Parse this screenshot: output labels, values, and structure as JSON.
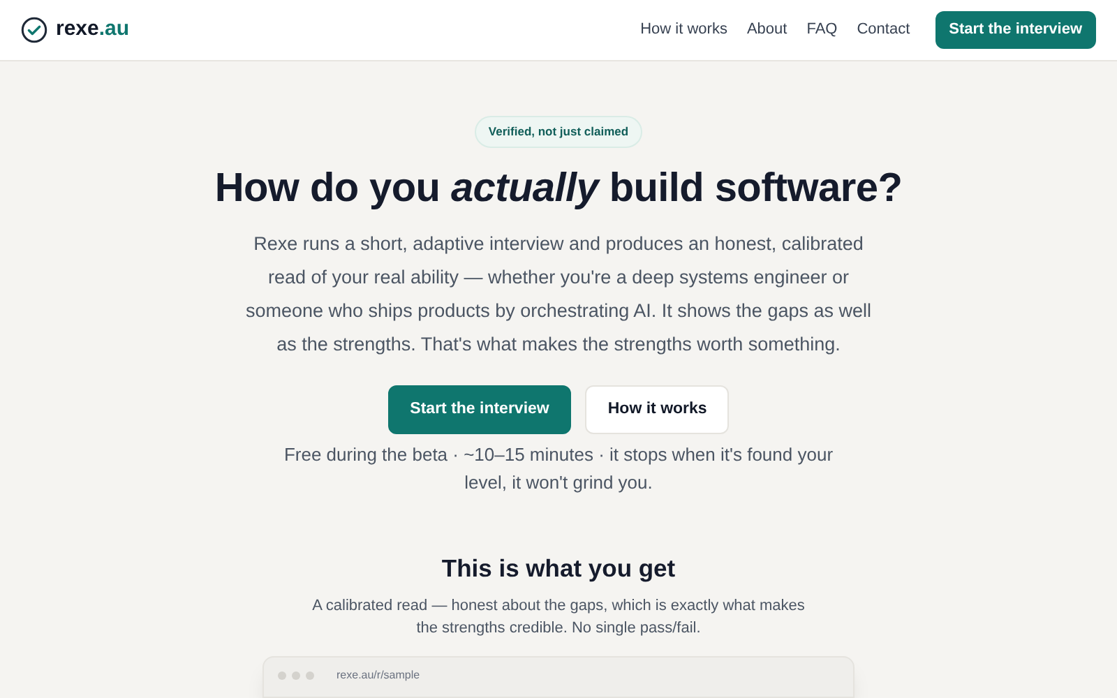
{
  "header": {
    "logo": {
      "name": "rexe",
      "tld": ".au"
    },
    "nav": [
      "How it works",
      "About",
      "FAQ",
      "Contact"
    ],
    "cta": "Start the interview"
  },
  "hero": {
    "badge": "Verified, not just claimed",
    "title": "How do you *actually* build software?",
    "description": "Rexe runs a short, adaptive interview and produces an honest, calibrated read of your real ability — whether you're a deep systems engineer or someone who ships products by orchestrating AI. It shows the gaps as well as the strengths. That's what makes the strengths worth something.",
    "buttons": [
      {
        "label": "Start the interview",
        "kind": "primary"
      },
      {
        "label": "How it works",
        "kind": "secondary"
      }
    ],
    "note": "Free during the beta · ~10–15 minutes · it stops when it's found your level, it won't grind you."
  },
  "section": {
    "title": "This is what you get",
    "description": "A calibrated read — honest about the gaps, which is exactly what makes the strengths credible. No single pass/fail.",
    "preview": {
      "url": "rexe.au/r/sample"
    }
  }
}
